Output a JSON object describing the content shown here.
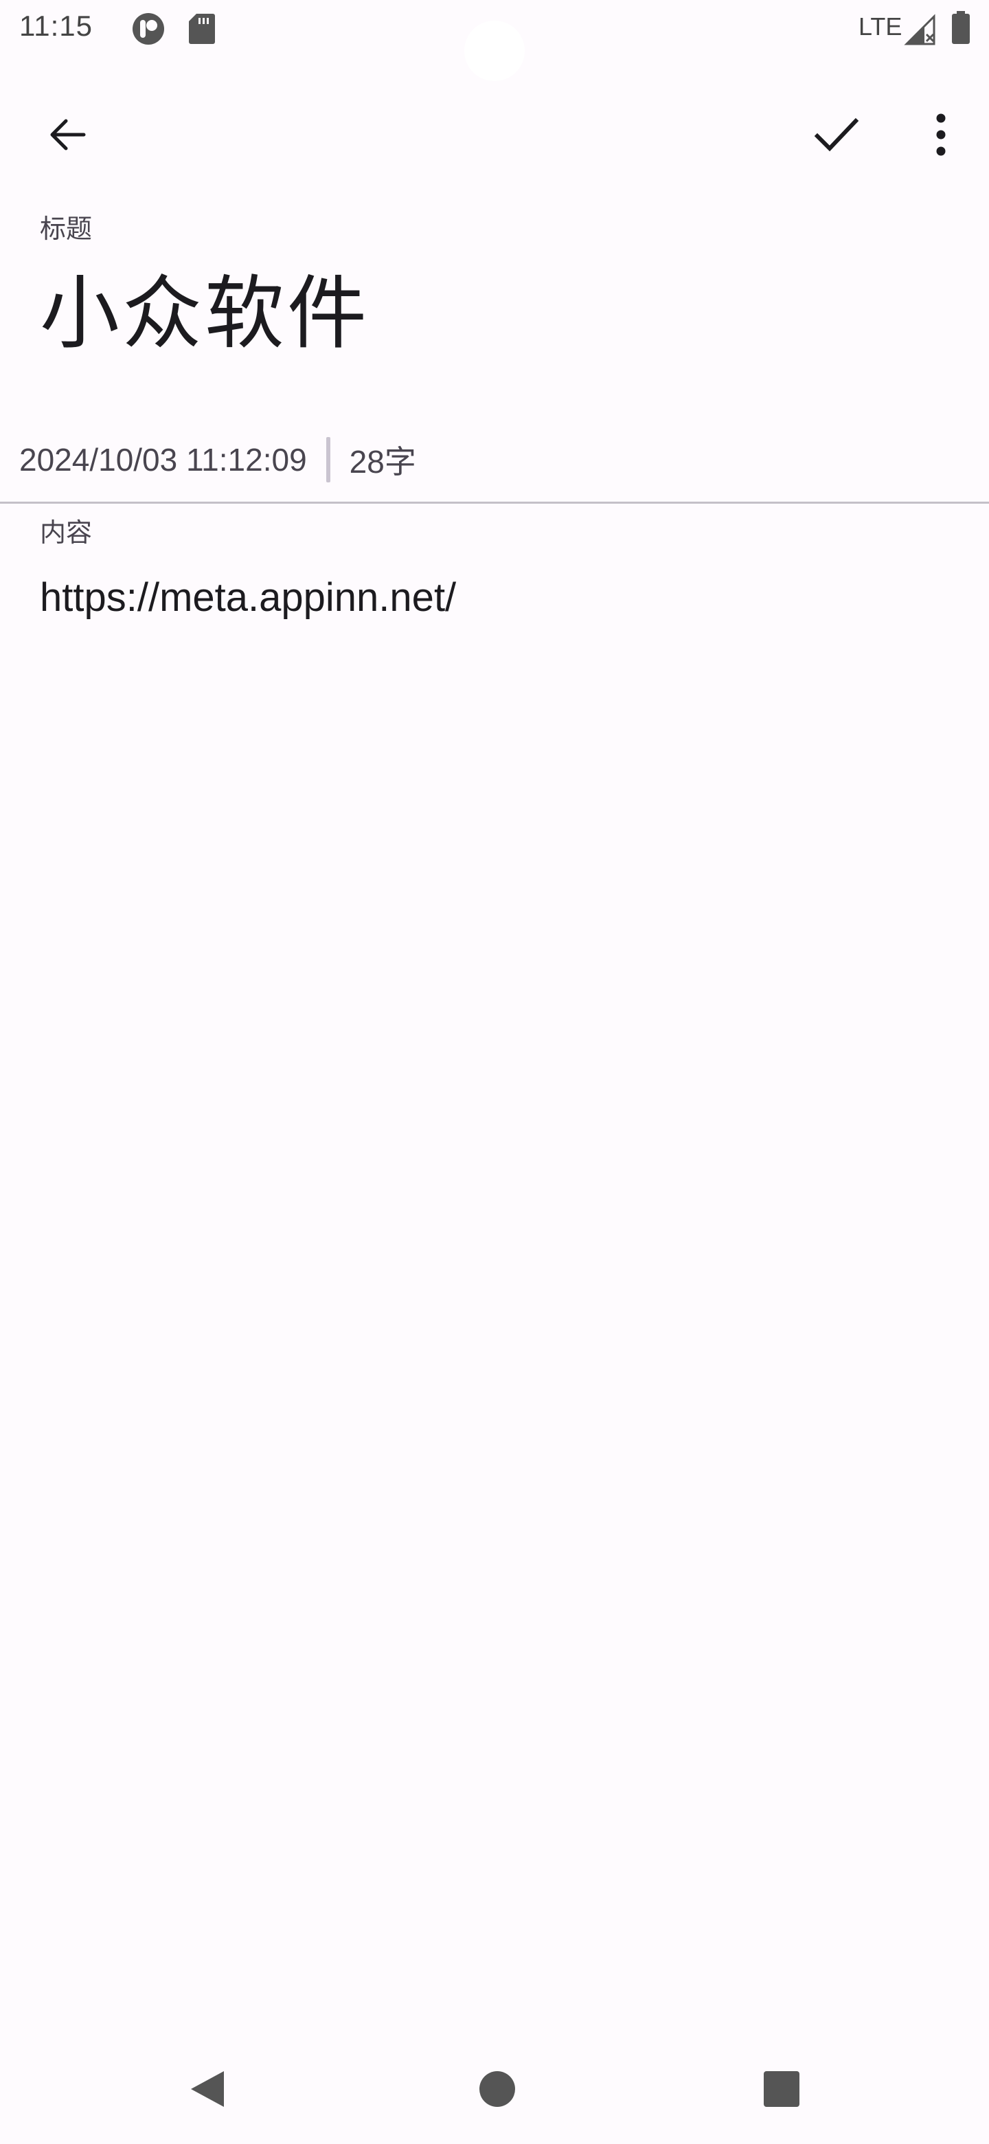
{
  "status_bar": {
    "time": "11:15",
    "network": "LTE"
  },
  "toolbar": {
    "back_icon": "arrow-back-icon",
    "save_icon": "check-icon",
    "more_icon": "more-vertical-icon"
  },
  "note": {
    "title_label": "标题",
    "title": "小众软件",
    "datetime": "2024/10/03 11:12:09",
    "char_count": "28字",
    "content_label": "内容",
    "content": "https://meta.appinn.net/"
  },
  "nav_bar": {
    "back_icon": "triangle-back-icon",
    "home_icon": "circle-home-icon",
    "recents_icon": "square-recents-icon"
  },
  "colors": {
    "background": "#fefbfe",
    "text_primary": "#1c1b1f",
    "text_secondary": "#49454f",
    "divider": "#c4c0c8"
  }
}
